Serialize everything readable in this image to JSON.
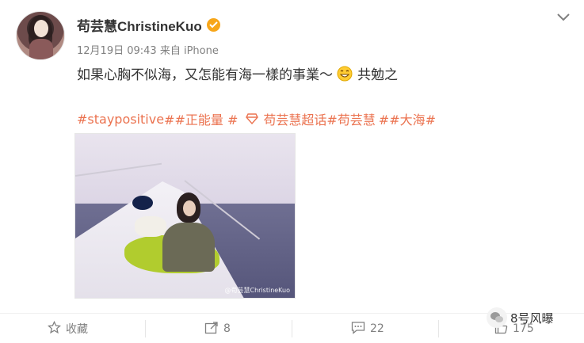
{
  "post": {
    "username": "苟芸慧ChristineKuo",
    "timestamp": "12月19日 09:43",
    "source": "来自 iPhone",
    "text_before_emoji": "如果心胸不似海，又怎能有海一樣的事業～",
    "text_after_emoji": "共勉之",
    "tags": {
      "tag1": "#staypositive",
      "tag2": "##正能量 #",
      "tag3": "苟芸慧超话",
      "tag4": "#苟芸慧",
      "tag5": "##大海#"
    },
    "photo_watermark": "@苟芸慧ChristineKuo"
  },
  "actions": {
    "favorite_label": "收藏",
    "repost_count": "8",
    "comment_count": "22",
    "like_count": "175"
  },
  "overlay": {
    "label": "8号风曝"
  },
  "colors": {
    "tag_color": "#eb7350",
    "verified_badge": "#f7a61a",
    "meta_text": "#808080"
  },
  "icons": {
    "verified": "verified-badge-icon",
    "dropdown": "chevron-down-icon",
    "emoji": "grin-emoji-icon",
    "supertopic": "diamond-icon",
    "favorite": "star-icon",
    "repost": "repost-icon",
    "comment": "comment-icon",
    "like": "thumbs-up-icon"
  }
}
